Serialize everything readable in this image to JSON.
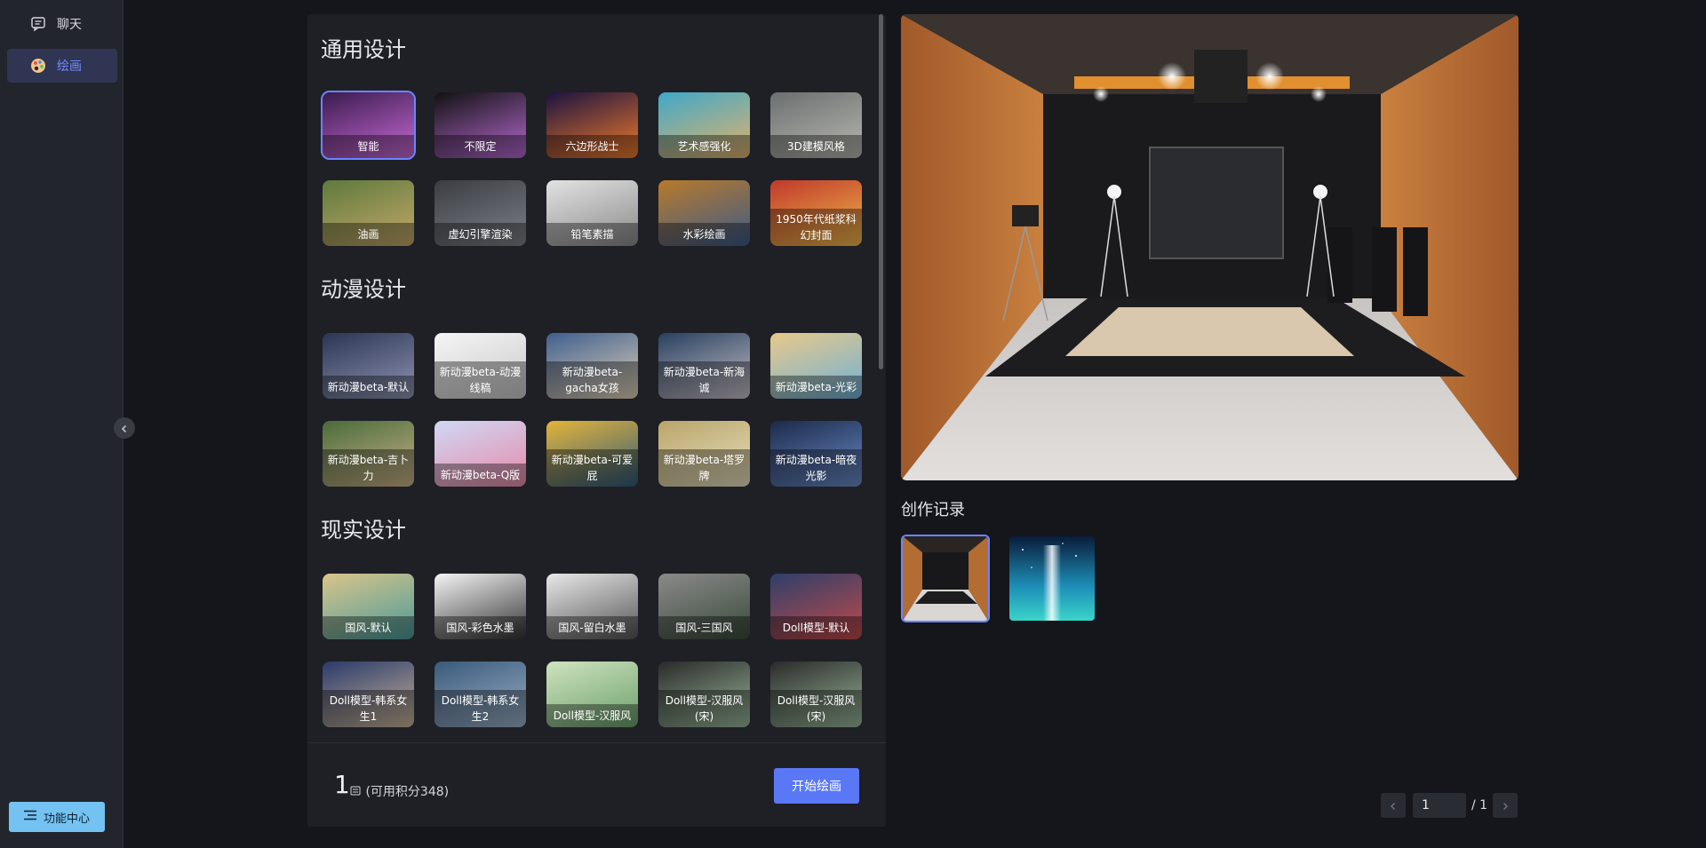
{
  "sidebar": {
    "items": [
      {
        "label": "聊天",
        "icon": "chat-icon"
      },
      {
        "label": "绘画",
        "icon": "palette-icon",
        "active": true
      }
    ],
    "feature_center": "功能中心"
  },
  "sections": [
    {
      "title": "通用设计",
      "styles": [
        "智能",
        "不限定",
        "六边形战士",
        "艺术感强化",
        "3D建模风格",
        "油画",
        "虚幻引擎渲染",
        "铅笔素描",
        "水彩绘画",
        "1950年代纸浆科幻封面"
      ]
    },
    {
      "title": "动漫设计",
      "styles": [
        "新动漫beta-默认",
        "新动漫beta-动漫线稿",
        "新动漫beta-gacha女孩",
        "新动漫beta-新海诚",
        "新动漫beta-光彩",
        "新动漫beta-吉卜力",
        "新动漫beta-Q版",
        "新动漫beta-可爱屁",
        "新动漫beta-塔罗牌",
        "新动漫beta-暗夜光影"
      ]
    },
    {
      "title": "现实设计",
      "styles": [
        "国风-默认",
        "国风-彩色水墨",
        "国风-留白水墨",
        "国风-三国风",
        "Doll模型-默认",
        "Doll模型-韩系女生1",
        "Doll模型-韩系女生2",
        "Doll模型-汉服风",
        "Doll模型-汉服风(宋)",
        "Doll模型-汉服风(宋)"
      ]
    }
  ],
  "selected_style": "智能",
  "footer": {
    "cost": "1",
    "cost_unit": "(可用积分348)",
    "start_button": "开始绘画"
  },
  "history": {
    "title": "创作记录"
  },
  "pager": {
    "current": "1",
    "total": "/ 1"
  },
  "colors": {
    "accent": "#5a78f6",
    "selected_border": "#6a86ff",
    "feature_button": "#74c2f2"
  }
}
